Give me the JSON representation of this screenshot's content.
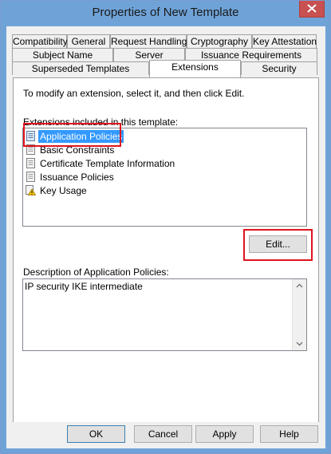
{
  "window": {
    "title": "Properties of New Template"
  },
  "tabs": {
    "row1": [
      "Compatibility",
      "General",
      "Request Handling",
      "Cryptography",
      "Key Attestation"
    ],
    "row2": [
      "Subject Name",
      "Server",
      "Issuance Requirements"
    ],
    "row3": [
      "Superseded Templates",
      "Extensions",
      "Security"
    ],
    "active": "Extensions"
  },
  "panel": {
    "instruction": "To modify an extension, select it, and then click Edit.",
    "list_label": "Extensions included in this template:",
    "extensions": [
      {
        "label": "Application Policies",
        "icon": "document-icon",
        "selected": true
      },
      {
        "label": "Basic Constraints",
        "icon": "document-icon"
      },
      {
        "label": "Certificate Template Information",
        "icon": "document-icon"
      },
      {
        "label": "Issuance Policies",
        "icon": "document-icon"
      },
      {
        "label": "Key Usage",
        "icon": "warning-icon"
      }
    ],
    "edit_label": "Edit...",
    "description_label": "Description of Application Policies:",
    "description_text": "IP security IKE intermediate"
  },
  "buttons": {
    "ok": "OK",
    "cancel": "Cancel",
    "apply": "Apply",
    "help": "Help"
  },
  "colors": {
    "titlebar": "#6fa3d8",
    "close": "#c75050",
    "selection": "#3399ff",
    "annotation": "#e0141e"
  }
}
